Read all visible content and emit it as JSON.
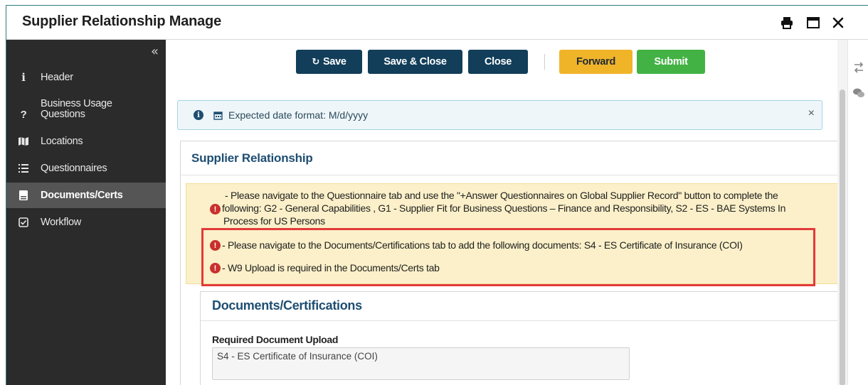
{
  "window": {
    "title": "Supplier Relationship Manage"
  },
  "titlebar": {
    "print_icon": "print-icon",
    "maximize_icon": "window-maximize-icon",
    "close_icon": "close-icon"
  },
  "sidebar": {
    "collapse_glyph": "«",
    "items": [
      {
        "icon": "info-icon",
        "glyph": "i",
        "label": "Header",
        "active": false
      },
      {
        "icon": "question-icon",
        "glyph": "?",
        "label": "Business Usage Questions",
        "active": false
      },
      {
        "icon": "map-icon",
        "glyph": "",
        "label": "Locations",
        "active": false
      },
      {
        "icon": "list-icon",
        "glyph": "",
        "label": "Questionnaires",
        "active": false
      },
      {
        "icon": "document-icon",
        "glyph": "",
        "label": "Documents/Certs",
        "active": true
      },
      {
        "icon": "checkbox-icon",
        "glyph": "",
        "label": "Workflow",
        "active": false
      }
    ]
  },
  "toolbar": {
    "save": "Save",
    "save_close": "Save & Close",
    "close": "Close",
    "forward": "Forward",
    "submit": "Submit"
  },
  "info_banner": {
    "text": "Expected date format: M/d/yyyy",
    "close": "×"
  },
  "panel": {
    "title": "Supplier Relationship",
    "warnings": {
      "line1a": "- Please navigate to the Questionnaire tab and use the \"+Answer Questionnaires on Global Supplier Record\" button to complete the",
      "line1b": "following: G2 - General Capabilities , G1 - Supplier Fit for Business Questions – Finance and Responsibility, S2 - ES - BAE Systems In",
      "line1c": "Process for US Persons",
      "line2": "- Please navigate to the Documents/Certifications tab to add the following documents: S4 - ES Certificate of Insurance (COI)",
      "line3": "- W9 Upload is required in the Documents/Certs tab"
    }
  },
  "documents": {
    "title": "Documents/Certifications",
    "required_label": "Required Document Upload",
    "required_value": "S4 - ES Certificate of Insurance (COI)"
  },
  "colors": {
    "dark_button": "#123e5a",
    "amber_button": "#f0b429",
    "green_button": "#43b244",
    "sidebar": "#2b2b2b",
    "warning_bg": "#fbf0c9",
    "error_red": "#c9302c",
    "highlight": "#e23a3a"
  }
}
